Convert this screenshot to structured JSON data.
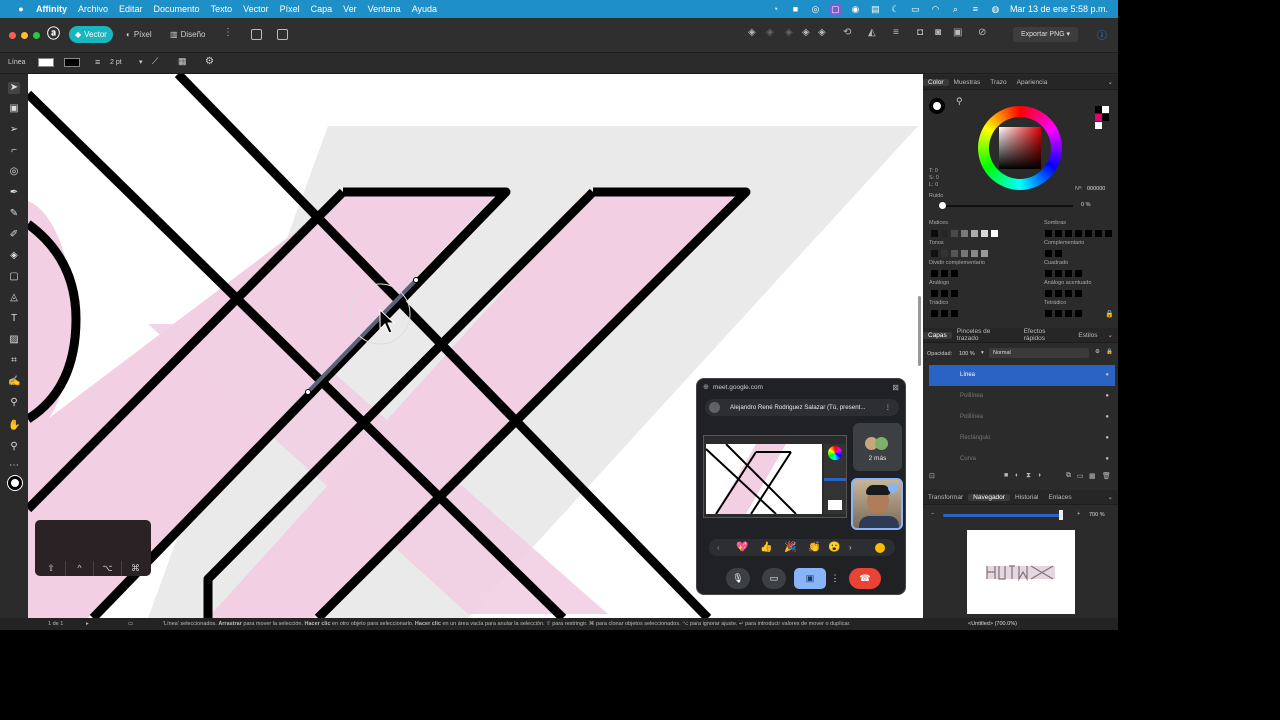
{
  "menubar": {
    "app": "Affinity",
    "items": [
      "Archivo",
      "Editar",
      "Documento",
      "Texto",
      "Vector",
      "Píxel",
      "Capa",
      "Ver",
      "Ventana",
      "Ayuda"
    ],
    "clock": "Mar 13 de ene  5:58 p.m."
  },
  "toolbar": {
    "personas": [
      "Vector",
      "Píxel",
      "Diseño"
    ],
    "export_label": "Exportar PNG"
  },
  "context": {
    "tool_label": "Línea",
    "stroke_width": "2 pt"
  },
  "right_panel": {
    "top_tabs": [
      "Color",
      "Muestras",
      "Trazo",
      "Apariencia"
    ],
    "hsl": [
      "T: 0",
      "S: 0",
      "L: 0"
    ],
    "hex_label": "Nº:",
    "hex_value": "000000",
    "noise_label": "Ruido",
    "noise_value": "0 %",
    "harmony_labels": [
      "Matices",
      "Sombras",
      "Tonos",
      "Complementario",
      "Dividir complementario",
      "Cuadrado",
      "Análogo",
      "Análogo acentuado",
      "Triádico",
      "Tetrádico"
    ],
    "layer_tabs": [
      "Capas",
      "Pinceles de trazado",
      "Efectos rápidos",
      "Estilos"
    ],
    "opacity_label": "Opacidad:",
    "opacity_value": "100 %",
    "blend_mode": "Normal",
    "layers": [
      "Línea",
      "Polilínea",
      "Polilínea",
      "Rectángulo",
      "Curva"
    ],
    "nav_tabs": [
      "Transformar",
      "Navegador",
      "Historial",
      "Enlaces"
    ],
    "zoom_value": "700 %"
  },
  "meet": {
    "url": "meet.google.com",
    "presenter": "Alejandro René Rodriguez Salazar (Tú, present...",
    "more_people": "2 más",
    "reactions": [
      "💖",
      "👍",
      "🎉",
      "👏",
      "😮"
    ]
  },
  "status": {
    "page": "1 de 1",
    "message_parts": [
      "'Línea' seleccionados. ",
      "Arrastrar",
      " para mover la selección. ",
      "Hacer clic",
      " en otro objeto para seleccionarlo. ",
      "Hacer clic",
      " en un área vacía para anular la selección. ⇧ para restringir. ⌘ para clonar objetos seleccionados. ⌥ para ignorar ajuste. ↵ para introducir valores de mover o duplicar."
    ],
    "doc": "<Untitled> (700.0%)"
  },
  "keys": [
    "⇧",
    "^",
    "⌥",
    "⌘"
  ],
  "colors": {
    "menubar": "#1f8fc8",
    "accent": "#1ab6bf",
    "layer_selected": "#2a63c4",
    "pink_fill": "#f2cfe3",
    "hangup": "#ea4335"
  }
}
